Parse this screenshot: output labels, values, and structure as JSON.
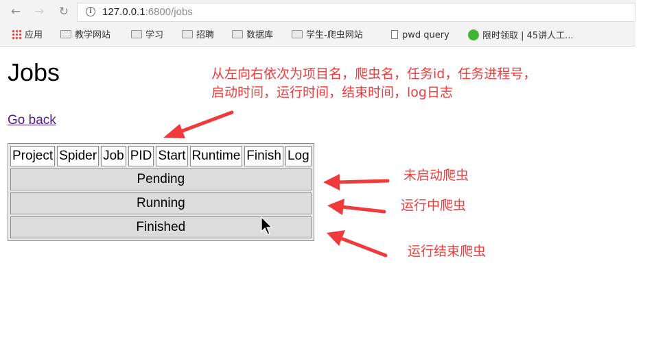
{
  "browser": {
    "back_glyph": "←",
    "forward_glyph": "→",
    "reload_glyph": "↻",
    "url_host": "127.0.0.1",
    "url_rest": ":6800/jobs",
    "info_glyph": "i",
    "bookmarks": [
      {
        "label": "应用",
        "icon": "apps-icon"
      },
      {
        "label": "教学网站",
        "icon": "folder-icon"
      },
      {
        "label": "学习",
        "icon": "folder-icon"
      },
      {
        "label": "招聘",
        "icon": "folder-icon"
      },
      {
        "label": "数据库",
        "icon": "folder-icon"
      },
      {
        "label": "学生-爬虫网站",
        "icon": "folder-icon"
      },
      {
        "label": "pwd query",
        "icon": "page-icon"
      },
      {
        "label": "限时领取 | 45讲人工...",
        "icon": "wechat-icon"
      }
    ]
  },
  "page": {
    "title": "Jobs",
    "go_back": "Go back",
    "columns": [
      "Project",
      "Spider",
      "Job",
      "PID",
      "Start",
      "Runtime",
      "Finish",
      "Log"
    ],
    "sections": {
      "pending": "Pending",
      "running": "Running",
      "finished": "Finished"
    }
  },
  "annotations": {
    "columns_line1": "从左向右依次为项目名，爬虫名，任务id，任务进程号，",
    "columns_line2": "启动时间，运行时间，结束时间，log日志",
    "pending": "未启动爬虫",
    "running": "运行中爬虫",
    "finished": "运行结束爬虫",
    "color": "#ef3b3b"
  },
  "colors": {
    "link_visited": "#551a8b",
    "section_bg": "#dcdcdc",
    "chrome_bg": "#f3f3f3"
  }
}
